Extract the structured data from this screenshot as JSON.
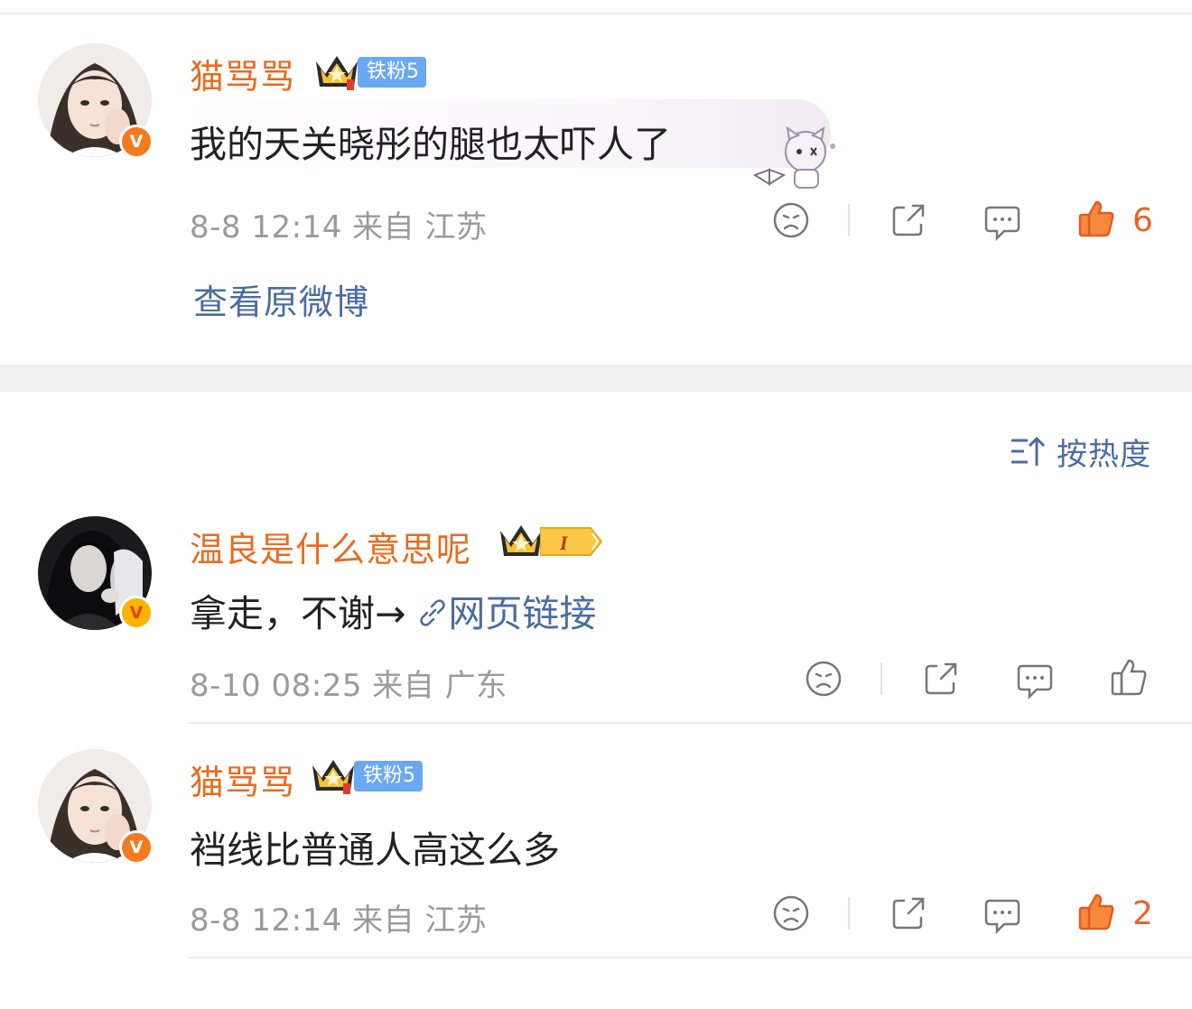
{
  "comments": [
    {
      "username": "猫骂骂",
      "fan_badge": "铁粉5",
      "text": "我的天关晓彤的腿也太吓人了",
      "date": "8-8 12:14",
      "location": "来自 江苏",
      "likes": "6"
    },
    {
      "username": "温良是什么意思呢",
      "text_prefix": "拿走，不谢→",
      "link_text": "网页链接",
      "date": "8-10 08:25",
      "location": "来自 广东"
    },
    {
      "username": "猫骂骂",
      "fan_badge": "铁粉5",
      "text": "裆线比普通人高这么多",
      "date": "8-8 12:14",
      "location": "来自 江苏",
      "likes": "2"
    }
  ],
  "view_original": "查看原微博",
  "sort_label": "按热度",
  "colors": {
    "username": "#e86b1f",
    "link": "#4a6da0",
    "like_active": "#e8632a",
    "meta": "#9a9a9a",
    "fan_badge": "#6aa8f2"
  },
  "icons": [
    "v-verified-icon",
    "crown-icon",
    "dislike-icon",
    "share-icon",
    "comment-icon",
    "like-icon",
    "link-icon",
    "sort-icon"
  ]
}
